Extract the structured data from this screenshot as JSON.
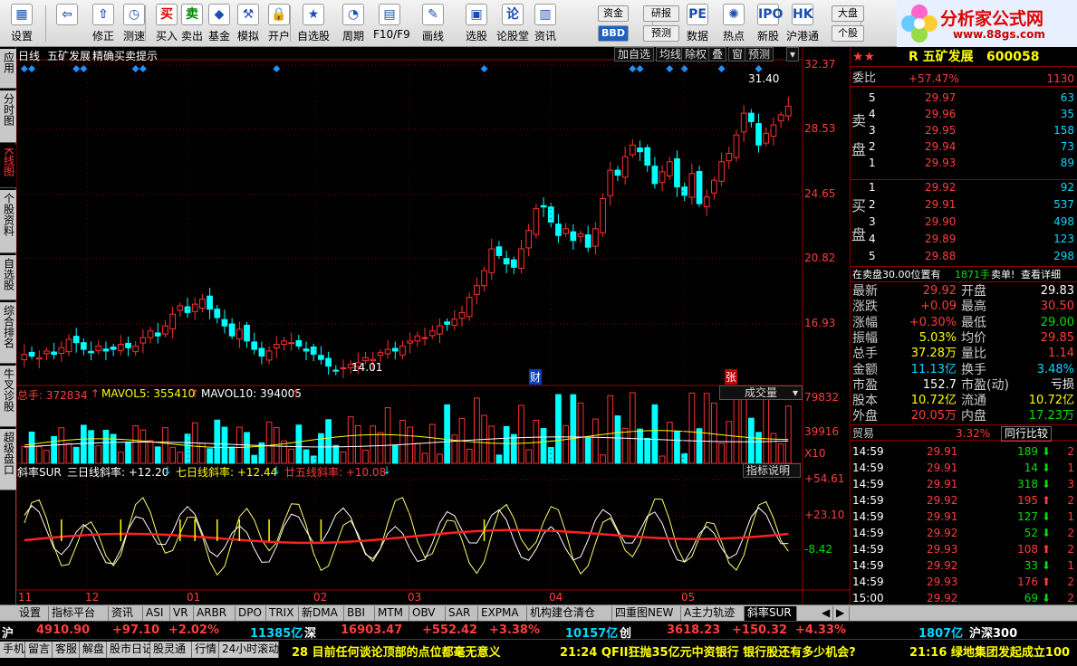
{
  "toolbar": {
    "items": [
      {
        "label": "设置",
        "icon": "grid-icon",
        "glyph": "▦",
        "x": 2
      },
      {
        "label": "",
        "icon": "back-arrow-icon",
        "glyph": "⇦",
        "x": 52
      },
      {
        "label": "修正",
        "icon": "up-arrow-icon",
        "glyph": "⇧",
        "x": 96
      },
      {
        "label": "测速",
        "icon": "clock-icon",
        "glyph": "◷",
        "x": 130
      },
      {
        "label": "买入",
        "icon": "buy-icon",
        "glyph": "买",
        "x": 166
      },
      {
        "label": "卖出",
        "icon": "sell-icon",
        "glyph": "卖",
        "x": 194
      },
      {
        "label": "基金",
        "icon": "fund-icon",
        "glyph": "◆",
        "x": 224
      },
      {
        "label": "模拟",
        "icon": "hammer-icon",
        "glyph": "⚒",
        "x": 256
      },
      {
        "label": "开户",
        "icon": "lock-icon",
        "glyph": "🔒",
        "x": 290
      },
      {
        "label": "自选股",
        "icon": "star-icon",
        "glyph": "★",
        "x": 328
      },
      {
        "label": "周期",
        "icon": "cycle-icon",
        "glyph": "◔",
        "x": 372
      },
      {
        "label": "F10/F9",
        "icon": "f10-icon",
        "glyph": "▤",
        "x": 412
      },
      {
        "label": "画线",
        "icon": "pencil-icon",
        "glyph": "✎",
        "x": 460
      },
      {
        "label": "选股",
        "icon": "screen-icon",
        "glyph": "▣",
        "x": 508
      },
      {
        "label": "论股堂",
        "icon": "discuss-icon",
        "glyph": "论",
        "x": 548
      },
      {
        "label": "资讯",
        "icon": "news-icon",
        "glyph": "▥",
        "x": 584
      },
      {
        "label": "数据",
        "icon": "data-icon",
        "glyph": "PE",
        "x": 752
      },
      {
        "label": "热点",
        "icon": "hot-icon",
        "glyph": "✺",
        "x": 792
      },
      {
        "label": "新股",
        "icon": "ipo-icon",
        "glyph": "IPO",
        "x": 830
      },
      {
        "label": "沪港通",
        "icon": "hk-icon",
        "glyph": "HK",
        "x": 868
      }
    ],
    "menus": [
      "资金",
      "BBD",
      "研报",
      "预测",
      "大盘",
      "个股"
    ],
    "bbd_label": "BBD"
  },
  "logo": {
    "text": "分析家公式网",
    "url": "www.88gs.com"
  },
  "left_tabs": [
    {
      "label": "应用",
      "active": false
    },
    {
      "label": "分时图",
      "active": false
    },
    {
      "label": "K线图",
      "active": true
    },
    {
      "label": "个股资料",
      "active": false
    },
    {
      "label": "自选股",
      "active": false
    },
    {
      "label": "综合排名",
      "active": false
    },
    {
      "label": "牛叉诊股",
      "active": false
    },
    {
      "label": "超级盘口",
      "active": false
    }
  ],
  "chart": {
    "header": {
      "period": "日线",
      "name": "五矿发展",
      "indicator": "精确买卖提示"
    },
    "buttons": [
      "加自选",
      "均线",
      "除权",
      "叠",
      "窗",
      "预测"
    ],
    "marks": {
      "high_label": "31.40",
      "low_label": "14.01",
      "cai": "财",
      "zhang": "张"
    },
    "vol_header": {
      "total": "总手: 372834",
      "ma5": "MAVOL5: 355410",
      "ma10": "MAVOL10: 394005",
      "select": "成交量"
    },
    "vol_axis": [
      "79832",
      "39916",
      "X10"
    ],
    "sur_header": {
      "name": "斜率SUR",
      "a": "三日线斜率: +12.20",
      "b": "七日线斜率: +12.44",
      "c": "廿五线斜率: +10.08",
      "btn": "指标说明"
    },
    "sur_axis": [
      "+54.61",
      "+23.10",
      "-8.42"
    ],
    "months": [
      "11",
      "12",
      "01",
      "02",
      "03",
      "04",
      "05"
    ]
  },
  "chart_data": {
    "type": "candlestick",
    "title": "五矿发展 日线",
    "y_ticks": [
      "32.37",
      "28.53",
      "24.65",
      "20.82",
      "16.93"
    ],
    "ylim": [
      14,
      32.37
    ],
    "closes": [
      15.1,
      15.0,
      14.9,
      15.3,
      15.1,
      15.5,
      16.0,
      15.8,
      15.4,
      15.2,
      15.6,
      15.3,
      15.4,
      15.7,
      15.5,
      15.6,
      16.1,
      16.5,
      16.2,
      16.8,
      17.5,
      18.0,
      17.6,
      18.1,
      18.4,
      17.8,
      17.3,
      16.8,
      16.2,
      16.6,
      15.9,
      15.4,
      15.0,
      15.3,
      15.7,
      15.9,
      15.8,
      15.6,
      15.3,
      15.1,
      14.8,
      14.4,
      14.1,
      14.3,
      14.5,
      14.6,
      14.9,
      14.8,
      15.2,
      15.4,
      15.3,
      15.6,
      15.9,
      16.2,
      16.1,
      16.5,
      16.8,
      16.9,
      17.2,
      17.6,
      18.5,
      19.2,
      20.1,
      21.4,
      21.0,
      20.5,
      20.3,
      21.4,
      22.5,
      23.8,
      23.9,
      23.0,
      22.2,
      22.6,
      21.9,
      22.3,
      21.5,
      22.6,
      24.4,
      26.1,
      25.8,
      26.9,
      27.6,
      27.2,
      26.4,
      25.3,
      26.0,
      26.6,
      25.1,
      24.6,
      25.9,
      24.1,
      24.5,
      25.5,
      26.6,
      27.1,
      28.2,
      29.5,
      29.0,
      27.6,
      28.3,
      28.8,
      29.4,
      29.92
    ],
    "volume_max": 79832,
    "sur": {
      "three_day": 12.2,
      "seven_day": 12.44,
      "twentyfive_day": 10.08
    }
  },
  "quote": {
    "stock": "R 五矿发展",
    "code": "600058",
    "weibi_label": "委比",
    "weibi": "+57.47%",
    "weicha": "1130",
    "sell_label": "卖盘",
    "buy_label": "买盘",
    "asks": [
      {
        "n": "5",
        "p": "29.97",
        "v": "63"
      },
      {
        "n": "4",
        "p": "29.96",
        "v": "35"
      },
      {
        "n": "3",
        "p": "29.95",
        "v": "158"
      },
      {
        "n": "2",
        "p": "29.94",
        "v": "73"
      },
      {
        "n": "1",
        "p": "29.93",
        "v": "89"
      }
    ],
    "bids": [
      {
        "n": "1",
        "p": "29.92",
        "v": "92"
      },
      {
        "n": "2",
        "p": "29.91",
        "v": "537"
      },
      {
        "n": "3",
        "p": "29.90",
        "v": "498"
      },
      {
        "n": "4",
        "p": "29.89",
        "v": "123"
      },
      {
        "n": "5",
        "p": "29.88",
        "v": "298"
      }
    ],
    "notice": {
      "a": "在卖盘30.00位置有",
      "b": "1871手",
      "c": "卖单!",
      "d": "查看详细"
    },
    "stats": [
      {
        "l1": "最新",
        "v1": "29.92",
        "c1": "red",
        "l2": "开盘",
        "v2": "29.83",
        "c2": "wht"
      },
      {
        "l1": "涨跌",
        "v1": "+0.09",
        "c1": "red",
        "l2": "最高",
        "v2": "30.50",
        "c2": "red"
      },
      {
        "l1": "涨幅",
        "v1": "+0.30%",
        "c1": "red",
        "l2": "最低",
        "v2": "29.00",
        "c2": "grn"
      },
      {
        "l1": "振幅",
        "v1": "5.03%",
        "c1": "yel",
        "l2": "均价",
        "v2": "29.85",
        "c2": "red"
      },
      {
        "l1": "总手",
        "v1": "37.28万",
        "c1": "yel",
        "l2": "量比",
        "v2": "1.14",
        "c2": "red"
      },
      {
        "l1": "金额",
        "v1": "11.13亿",
        "c1": "cyn",
        "l2": "换手",
        "v2": "3.48%",
        "c2": "cyn"
      },
      {
        "l1": "市盈",
        "v1": "152.7",
        "c1": "wht",
        "l2": "市盈(动)",
        "v2": "亏损",
        "c2": "wht"
      },
      {
        "l1": "股本",
        "v1": "10.72亿",
        "c1": "yel",
        "l2": "流通",
        "v2": "10.72亿",
        "c2": "yel"
      },
      {
        "l1": "外盘",
        "v1": "20.05万",
        "c1": "red",
        "l2": "内盘",
        "v2": "17.23万",
        "c2": "grn"
      }
    ],
    "trade_label": "贸易",
    "trade_pct": "3.32%",
    "compare_btn": "同行比较",
    "ticks": [
      {
        "t": "14:59",
        "p": "29.91",
        "c": "red",
        "v": "189",
        "d": "down",
        "n": "2"
      },
      {
        "t": "14:59",
        "p": "29.91",
        "c": "red",
        "v": "14",
        "d": "down",
        "n": "1"
      },
      {
        "t": "14:59",
        "p": "29.91",
        "c": "red",
        "v": "318",
        "d": "down",
        "n": "3"
      },
      {
        "t": "14:59",
        "p": "29.92",
        "c": "red",
        "v": "195",
        "d": "up",
        "n": "2"
      },
      {
        "t": "14:59",
        "p": "29.91",
        "c": "red",
        "v": "127",
        "d": "down",
        "n": "1"
      },
      {
        "t": "14:59",
        "p": "29.92",
        "c": "red",
        "v": "52",
        "d": "down",
        "n": "2"
      },
      {
        "t": "14:59",
        "p": "29.93",
        "c": "red",
        "v": "108",
        "d": "up",
        "n": "2"
      },
      {
        "t": "14:59",
        "p": "29.92",
        "c": "red",
        "v": "33",
        "d": "down",
        "n": "1"
      },
      {
        "t": "14:59",
        "p": "29.93",
        "c": "red",
        "v": "176",
        "d": "up",
        "n": "2"
      },
      {
        "t": "15:00",
        "p": "29.92",
        "c": "red",
        "v": "69",
        "d": "down",
        "n": "2"
      }
    ],
    "tabs": [
      "细",
      "诊",
      "分",
      "筹",
      "焰",
      "指",
      "财"
    ]
  },
  "bottom_tabs": [
    "设置",
    "指标平台",
    "资讯",
    "ASI",
    "VR",
    "ARBR",
    "DPO",
    "TRIX",
    "新DMA",
    "BBI",
    "MTM",
    "OBV",
    "SAR",
    "EXPMA",
    "机构建仓清仓",
    "四重图NEW",
    "A主力轨迹",
    "斜率SUR"
  ],
  "ticker": {
    "sh_label": "沪",
    "sh_idx": "4910.90",
    "sh_chg": "+97.10",
    "sh_pct": "+2.02%",
    "sh_amt": "11385亿",
    "sz_label": "深",
    "sz_idx": "16903.47",
    "sz_chg": "+552.42",
    "sz_pct": "+3.38%",
    "sz_amt": "10157亿",
    "cy_label": "创",
    "cy_idx": "3618.23",
    "cy_chg": "+150.32",
    "cy_pct": "+4.33%",
    "cy_amt": "1807亿",
    "hs_label": "沪深300"
  },
  "news_tabs": [
    "手机",
    "留言",
    "客服",
    "解盘",
    "股市日记",
    "股灵通",
    "行情",
    "24小时滚动"
  ],
  "news": [
    "28 目前任何谈论顶部的点位都毫无意义",
    "21:24 QFII狂抛35亿元中资银行 银行股还有多少机会?",
    "21:16 绿地集团发起成立100"
  ]
}
